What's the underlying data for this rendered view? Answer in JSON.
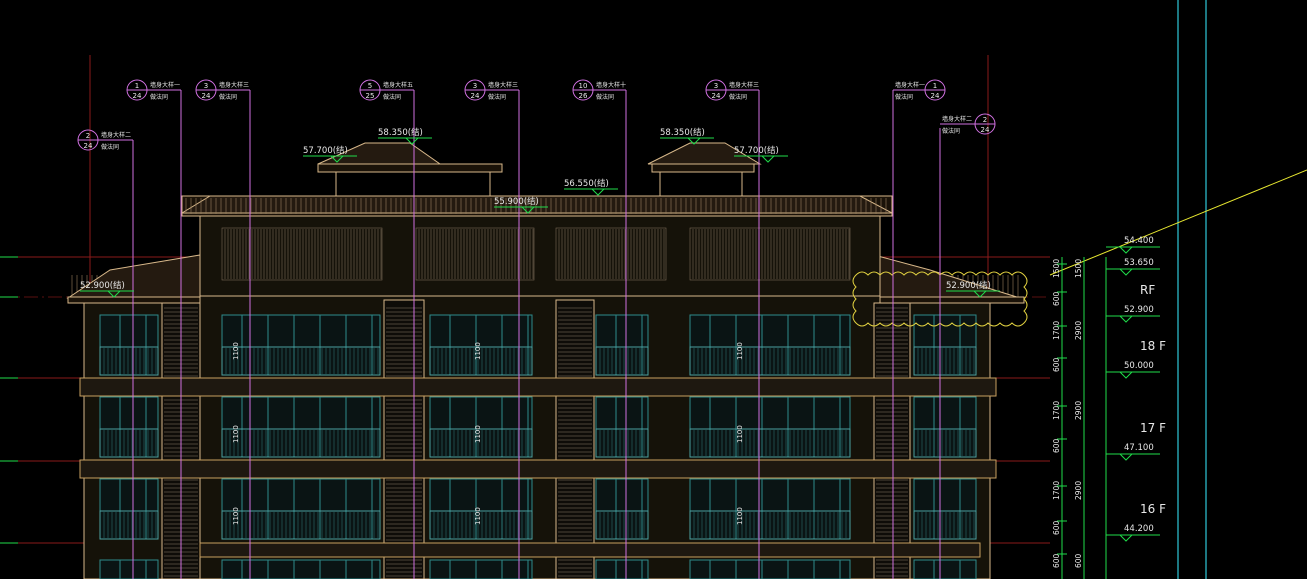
{
  "colors": {
    "background": "#000000",
    "building_outline": "#d8b88a",
    "gridline_red": "#8a1a1a",
    "leader_magenta": "#d070e0",
    "dimension_green": "#1fdc4a",
    "level_text_white": "#e8e8e8",
    "glazing_teal": "#2e8b8b",
    "cyan_border": "#30c8d8",
    "yellow_highlight": "#e8e830",
    "cloud_yellow": "#e0d040"
  },
  "callouts": [
    {
      "num": "1",
      "sheet": "24",
      "text1": "墙身大样一",
      "text2": "做法同"
    },
    {
      "num": "3",
      "sheet": "24",
      "text1": "墙身大样三",
      "text2": "做法同"
    },
    {
      "num": "5",
      "sheet": "25",
      "text1": "墙身大样五",
      "text2": "做法同"
    },
    {
      "num": "3",
      "sheet": "24",
      "text1": "墙身大样三",
      "text2": "做法同"
    },
    {
      "num": "10",
      "sheet": "26",
      "text1": "墙身大样十",
      "text2": "做法同"
    },
    {
      "num": "3",
      "sheet": "24",
      "text1": "墙身大样三",
      "text2": "做法同"
    },
    {
      "num": "1",
      "sheet": "24",
      "text1": "墙身大样一",
      "text2": "做法同"
    },
    {
      "num": "2",
      "sheet": "24",
      "text1": "墙身大样二",
      "text2": "做法同"
    },
    {
      "num": "2",
      "sheet": "24",
      "text1": "墙身大样二",
      "text2": "做法同"
    }
  ],
  "elevation_marks": [
    "58.350(结)",
    "57.700(结)",
    "58.350(结)",
    "57.700(结)",
    "56.550(结)",
    "55.900(结)",
    "52.900(结)",
    "52.900(结)"
  ],
  "right_levels": [
    {
      "value": "54.400"
    },
    {
      "value": "53.650"
    },
    {
      "value": "52.900",
      "floor": "RF"
    },
    {
      "value": "50.000",
      "floor": "18 F"
    },
    {
      "value": "47.100",
      "floor": "17 F"
    },
    {
      "value": "44.200",
      "floor": "16 F"
    }
  ],
  "dimensions": {
    "inner": [
      "1500",
      "600",
      "1700",
      "600",
      "1700",
      "600",
      "1700",
      "600",
      "600"
    ],
    "outer": [
      "1500",
      "2900",
      "2900",
      "2900",
      "600"
    ]
  },
  "railing_heights": [
    "1100",
    "1100",
    "1100",
    "1100",
    "1100",
    "1100",
    "1100",
    "1100",
    "1100"
  ]
}
